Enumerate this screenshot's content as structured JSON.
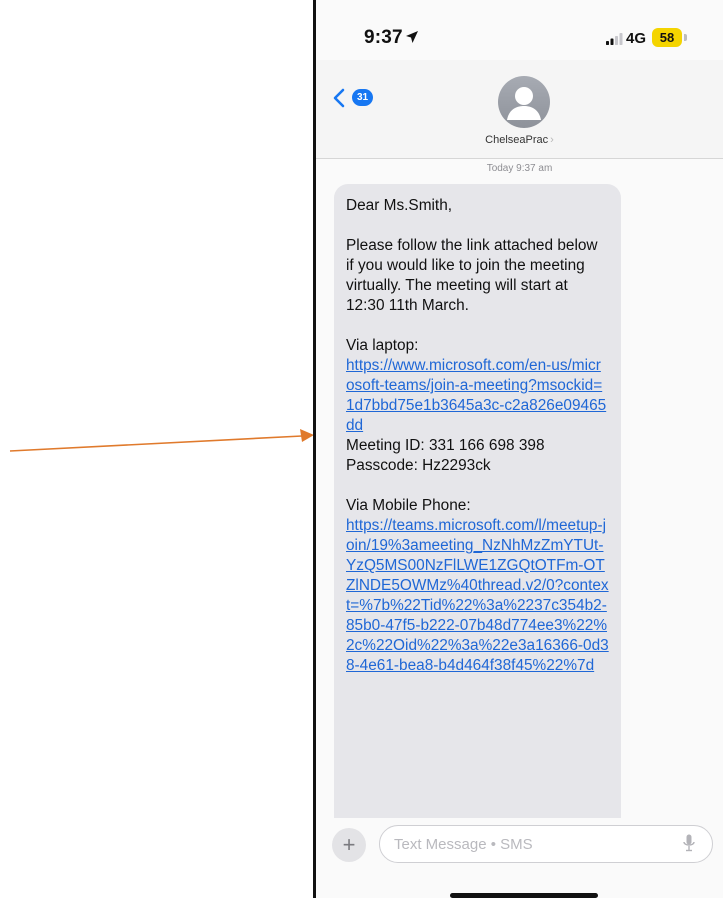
{
  "status_bar": {
    "time": "9:37",
    "network": "4G",
    "battery": "58"
  },
  "header": {
    "back_badge": "31",
    "contact_name": "ChelseaPrac",
    "contact_chevron": "›"
  },
  "conversation": {
    "timestamp": "Today 9:37 am",
    "message": {
      "greeting": "Dear Ms.Smith,",
      "body": "Please follow the link attached below if you would like to join the meeting virtually. The meeting will start at 12:30 11th March.",
      "laptop_heading": "Via laptop:",
      "laptop_link": "https://www.microsoft.com/en-us/microsoft-teams/join-a-meeting?msockid=1d7bbd75e1b3645a3c-c2a826e09465dd",
      "meeting_id": "Meeting ID: 331 166 698 398",
      "passcode": "Passcode: Hz2293ck",
      "mobile_heading": "Via Mobile Phone:",
      "mobile_link": "https://teams.microsoft.com/l/meetup-join/19%3ameeting_NzNhMzZmYTUt-YzQ5MS00NzFlLWE1ZGQtOTFm-OTZlNDE5OWMz%40thread.v2/0?context=%7b%22Tid%22%3a%2237c354b2-85b0-47f5-b222-07b48d774ee3%22%2c%22Oid%22%3a%22e3a16366-0d38-4e61-bea8-b4d464f38f45%22%7d"
    }
  },
  "composer": {
    "plus": "+",
    "placeholder": "Text Message • SMS"
  },
  "colors": {
    "accent": "#1777f2",
    "link": "#1f67d6",
    "bubble": "#e6e6ea",
    "arrow": "#e07a2c",
    "battery": "#f4d400"
  },
  "icons": [
    "location-arrow-icon",
    "signal-bars-icon",
    "back-chevron-icon",
    "person-icon",
    "microphone-icon",
    "arrow-annotation-icon"
  ]
}
